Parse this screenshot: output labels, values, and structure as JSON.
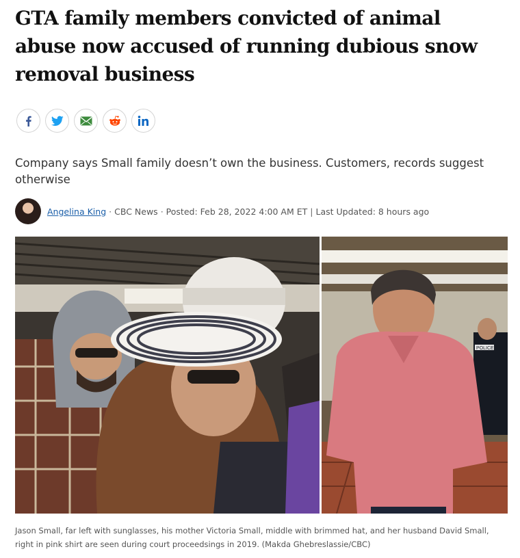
{
  "article": {
    "headline": "GTA family members convicted of animal abuse now accused of running dubious snow removal business",
    "deck": "Company says Small family doesn’t own the business. Customers, records suggest otherwise",
    "byline": {
      "author": "Angelina King",
      "outlet": "CBC News",
      "posted": "Posted: Feb 28, 2022 4:00 AM ET",
      "updated": "Last Updated: 8 hours ago",
      "dot_separator": "·",
      "bar_separator": "|"
    },
    "photo": {
      "caption": "Jason Small, far left with sunglasses, his mother Victoria Small, middle with brimmed hat, and her husband David Small, right in pink shirt are seen during court proceedsings in 2019. (Makda Ghebreslassie/CBC)",
      "badge_text": "POLICE"
    }
  },
  "share": {
    "buttons": [
      {
        "icon": "facebook-icon",
        "color": "#3b5998"
      },
      {
        "icon": "twitter-icon",
        "color": "#1da1f2"
      },
      {
        "icon": "email-icon",
        "color": "#3d8b3d"
      },
      {
        "icon": "reddit-icon",
        "color": "#ff4500"
      },
      {
        "icon": "linkedin-icon",
        "color": "#0a66c2"
      }
    ]
  },
  "colors": {
    "link": "#1a5ea8",
    "headline": "#111111"
  }
}
